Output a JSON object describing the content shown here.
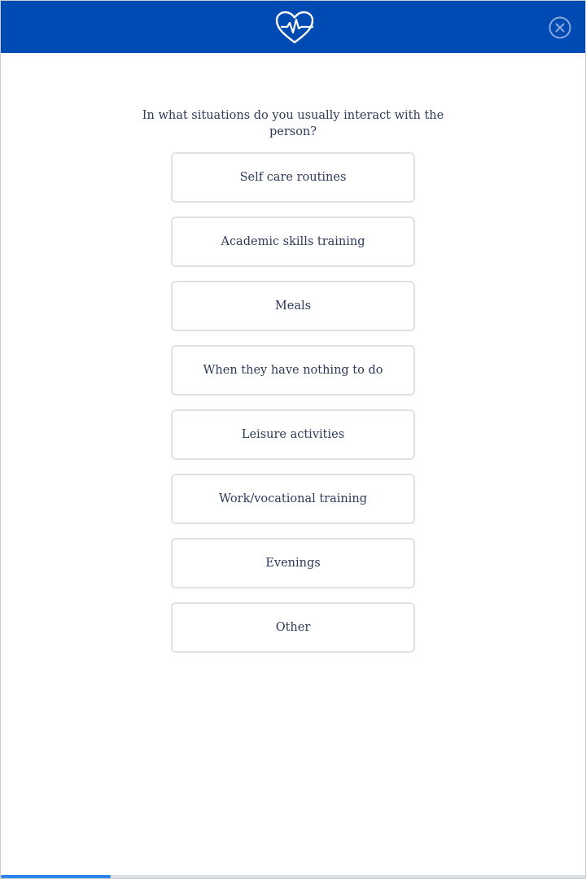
{
  "header": {
    "logo_icon": "heart-pulse-icon",
    "close_icon": "close-circle-icon",
    "background": "#004ab3"
  },
  "question": "In what situations do you usually interact with the person?",
  "options": [
    "Self care routines",
    "Academic skills training",
    "Meals",
    "When they have nothing to do",
    "Leisure activities",
    "Work/vocational training",
    "Evenings",
    "Other"
  ],
  "progress": {
    "percent": 18.75,
    "color": "#2e86ea"
  }
}
